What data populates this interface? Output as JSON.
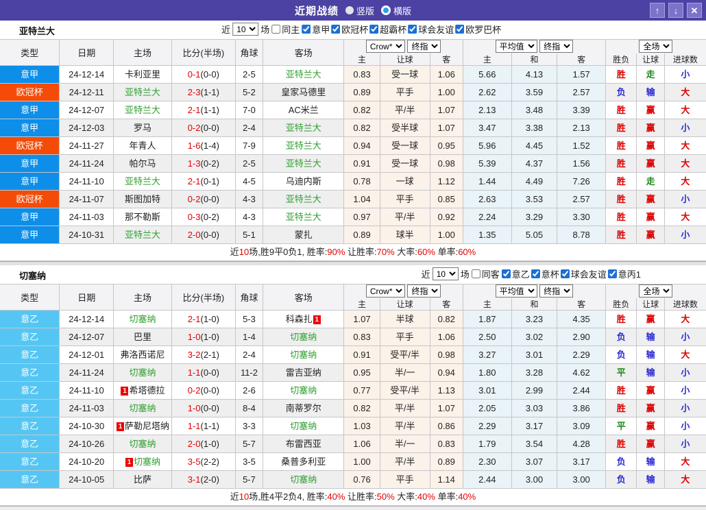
{
  "titlebar": {
    "title": "近期战绩",
    "vertical_label": "竖版",
    "horizontal_label": "横版",
    "selected_layout": "横版",
    "buttons": {
      "up": "↑",
      "down": "↓",
      "close": "✕"
    }
  },
  "table_header": {
    "type": "类型",
    "date": "日期",
    "home": "主场",
    "score": "比分(半场)",
    "corner": "角球",
    "away": "客场",
    "odds_source": "Crow*",
    "odds_kind": "终指",
    "avg_source": "平均值",
    "avg_kind": "终指",
    "scope_select": "全场",
    "h_home": "主",
    "h_handicap": "让球",
    "h_away": "客",
    "a_home": "主",
    "a_draw": "和",
    "a_away": "客",
    "r_wdl": "胜负",
    "r_handicap": "让球",
    "r_goals": "进球数"
  },
  "colors": {
    "titlebar_bg": "#4b42a3",
    "leagues": {
      "意甲": "#0d8ee9",
      "欧冠杯": "#f44c08",
      "意乙": "#55c6f3"
    },
    "results": {
      "胜": "#dd0000",
      "负": "#2a2ad2",
      "平": "#1d8a1d",
      "赢": "#dd0000",
      "输": "#2a2ad2",
      "走": "#1d8a1d",
      "大": "#dd0000",
      "小": "#2a2ad2"
    },
    "team_highlight": "#2f9e2f",
    "score_red": "#e10000",
    "red_card": "#ee0000"
  },
  "sections": [
    {
      "team": "亚特兰大",
      "filter": {
        "near": "近",
        "count": "10",
        "games": "场",
        "same": "同主",
        "comps": [
          "意甲",
          "欧冠杯",
          "超霸杯",
          "球会友谊",
          "欧罗巴杯"
        ]
      },
      "rows": [
        {
          "lg": "意甲",
          "date": "24-12-14",
          "home": "卡利亚里",
          "ft": "0-1",
          "half": "(0-0)",
          "corner": "2-5",
          "away": "亚特兰大",
          "ateam": true,
          "o": [
            "0.83",
            "受一球",
            "1.06"
          ],
          "avg": [
            "5.66",
            "4.13",
            "1.57"
          ],
          "res": [
            "胜",
            "走",
            "小"
          ]
        },
        {
          "lg": "欧冠杯",
          "date": "24-12-11",
          "home": "亚特兰大",
          "hteam": true,
          "ft": "2-3",
          "half": "(1-1)",
          "corner": "5-2",
          "away": "皇家马德里",
          "o": [
            "0.89",
            "平手",
            "1.00"
          ],
          "avg": [
            "2.62",
            "3.59",
            "2.57"
          ],
          "res": [
            "负",
            "输",
            "大"
          ]
        },
        {
          "lg": "意甲",
          "date": "24-12-07",
          "home": "亚特兰大",
          "hteam": true,
          "ft": "2-1",
          "half": "(1-1)",
          "corner": "7-0",
          "away": "AC米兰",
          "o": [
            "0.82",
            "平/半",
            "1.07"
          ],
          "avg": [
            "2.13",
            "3.48",
            "3.39"
          ],
          "res": [
            "胜",
            "赢",
            "大"
          ]
        },
        {
          "lg": "意甲",
          "date": "24-12-03",
          "home": "罗马",
          "ft": "0-2",
          "half": "(0-0)",
          "corner": "2-4",
          "away": "亚特兰大",
          "ateam": true,
          "o": [
            "0.82",
            "受半球",
            "1.07"
          ],
          "avg": [
            "3.47",
            "3.38",
            "2.13"
          ],
          "res": [
            "胜",
            "赢",
            "小"
          ]
        },
        {
          "lg": "欧冠杯",
          "date": "24-11-27",
          "home": "年青人",
          "ft": "1-6",
          "half": "(1-4)",
          "corner": "7-9",
          "away": "亚特兰大",
          "ateam": true,
          "o": [
            "0.94",
            "受一球",
            "0.95"
          ],
          "avg": [
            "5.96",
            "4.45",
            "1.52"
          ],
          "res": [
            "胜",
            "赢",
            "大"
          ]
        },
        {
          "lg": "意甲",
          "date": "24-11-24",
          "home": "帕尔马",
          "ft": "1-3",
          "half": "(0-2)",
          "corner": "2-5",
          "away": "亚特兰大",
          "ateam": true,
          "o": [
            "0.91",
            "受一球",
            "0.98"
          ],
          "avg": [
            "5.39",
            "4.37",
            "1.56"
          ],
          "res": [
            "胜",
            "赢",
            "大"
          ]
        },
        {
          "lg": "意甲",
          "date": "24-11-10",
          "home": "亚特兰大",
          "hteam": true,
          "ft": "2-1",
          "half": "(0-1)",
          "corner": "4-5",
          "away": "乌迪内斯",
          "o": [
            "0.78",
            "一球",
            "1.12"
          ],
          "avg": [
            "1.44",
            "4.49",
            "7.26"
          ],
          "res": [
            "胜",
            "走",
            "大"
          ]
        },
        {
          "lg": "欧冠杯",
          "date": "24-11-07",
          "home": "斯图加特",
          "ft": "0-2",
          "half": "(0-0)",
          "corner": "4-3",
          "away": "亚特兰大",
          "ateam": true,
          "o": [
            "1.04",
            "平手",
            "0.85"
          ],
          "avg": [
            "2.63",
            "3.53",
            "2.57"
          ],
          "res": [
            "胜",
            "赢",
            "小"
          ]
        },
        {
          "lg": "意甲",
          "date": "24-11-03",
          "home": "那不勒斯",
          "ft": "0-3",
          "half": "(0-2)",
          "corner": "4-3",
          "away": "亚特兰大",
          "ateam": true,
          "o": [
            "0.97",
            "平/半",
            "0.92"
          ],
          "avg": [
            "2.24",
            "3.29",
            "3.30"
          ],
          "res": [
            "胜",
            "赢",
            "大"
          ]
        },
        {
          "lg": "意甲",
          "date": "24-10-31",
          "home": "亚特兰大",
          "hteam": true,
          "ft": "2-0",
          "half": "(0-0)",
          "corner": "5-1",
          "away": "蒙扎",
          "o": [
            "0.89",
            "球半",
            "1.00"
          ],
          "avg": [
            "1.35",
            "5.05",
            "8.78"
          ],
          "res": [
            "胜",
            "赢",
            "小"
          ]
        }
      ],
      "summary": [
        {
          "t": "近"
        },
        {
          "t": "10",
          "red": true
        },
        {
          "t": "场,胜9平0负1, 胜率:"
        },
        {
          "t": "90%",
          "red": true
        },
        {
          "t": " 让胜率:"
        },
        {
          "t": "70%",
          "red": true
        },
        {
          "t": " 大率:"
        },
        {
          "t": "60%",
          "red": true
        },
        {
          "t": " 单率:"
        },
        {
          "t": "60%",
          "red": true
        }
      ]
    },
    {
      "team": "切塞纳",
      "filter": {
        "near": "近",
        "count": "10",
        "games": "场",
        "same": "同客",
        "comps": [
          "意乙",
          "意杯",
          "球会友谊",
          "意丙1"
        ]
      },
      "rows": [
        {
          "lg": "意乙",
          "date": "24-12-14",
          "home": "切塞纳",
          "hteam": true,
          "ft": "2-1",
          "half": "(1-0)",
          "corner": "5-3",
          "away": "科森扎",
          "arc": "post",
          "o": [
            "1.07",
            "半球",
            "0.82"
          ],
          "avg": [
            "1.87",
            "3.23",
            "4.35"
          ],
          "res": [
            "胜",
            "赢",
            "大"
          ]
        },
        {
          "lg": "意乙",
          "date": "24-12-07",
          "home": "巴里",
          "ft": "1-0",
          "half": "(1-0)",
          "corner": "1-4",
          "away": "切塞纳",
          "ateam": true,
          "o": [
            "0.83",
            "平手",
            "1.06"
          ],
          "avg": [
            "2.50",
            "3.02",
            "2.90"
          ],
          "res": [
            "负",
            "输",
            "小"
          ]
        },
        {
          "lg": "意乙",
          "date": "24-12-01",
          "home": "弗洛西诺尼",
          "ft": "3-2",
          "half": "(2-1)",
          "corner": "2-4",
          "away": "切塞纳",
          "ateam": true,
          "o": [
            "0.91",
            "受平/半",
            "0.98"
          ],
          "avg": [
            "3.27",
            "3.01",
            "2.29"
          ],
          "res": [
            "负",
            "输",
            "大"
          ]
        },
        {
          "lg": "意乙",
          "date": "24-11-24",
          "home": "切塞纳",
          "hteam": true,
          "ft": "1-1",
          "half": "(0-0)",
          "corner": "11-2",
          "away": "雷吉亚纳",
          "o": [
            "0.95",
            "半/一",
            "0.94"
          ],
          "avg": [
            "1.80",
            "3.28",
            "4.62"
          ],
          "res": [
            "平",
            "输",
            "小"
          ]
        },
        {
          "lg": "意乙",
          "date": "24-11-10",
          "home": "希塔德拉",
          "hrc": "pre",
          "ft": "0-2",
          "half": "(0-0)",
          "corner": "2-6",
          "away": "切塞纳",
          "ateam": true,
          "o": [
            "0.77",
            "受平/半",
            "1.13"
          ],
          "avg": [
            "3.01",
            "2.99",
            "2.44"
          ],
          "res": [
            "胜",
            "赢",
            "小"
          ]
        },
        {
          "lg": "意乙",
          "date": "24-11-03",
          "home": "切塞纳",
          "hteam": true,
          "ft": "1-0",
          "half": "(0-0)",
          "corner": "8-4",
          "away": "南蒂罗尔",
          "o": [
            "0.82",
            "平/半",
            "1.07"
          ],
          "avg": [
            "2.05",
            "3.03",
            "3.86"
          ],
          "res": [
            "胜",
            "赢",
            "小"
          ]
        },
        {
          "lg": "意乙",
          "date": "24-10-30",
          "home": "萨勒尼塔纳",
          "hrc": "pre",
          "ft": "1-1",
          "half": "(1-1)",
          "corner": "3-3",
          "away": "切塞纳",
          "ateam": true,
          "o": [
            "1.03",
            "平/半",
            "0.86"
          ],
          "avg": [
            "2.29",
            "3.17",
            "3.09"
          ],
          "res": [
            "平",
            "赢",
            "小"
          ]
        },
        {
          "lg": "意乙",
          "date": "24-10-26",
          "home": "切塞纳",
          "hteam": true,
          "ft": "2-0",
          "half": "(1-0)",
          "corner": "5-7",
          "away": "布雷西亚",
          "o": [
            "1.06",
            "半/一",
            "0.83"
          ],
          "avg": [
            "1.79",
            "3.54",
            "4.28"
          ],
          "res": [
            "胜",
            "赢",
            "小"
          ]
        },
        {
          "lg": "意乙",
          "date": "24-10-20",
          "home": "切塞纳",
          "hteam": true,
          "hrc": "pre",
          "ft": "3-5",
          "half": "(2-2)",
          "corner": "3-5",
          "away": "桑普多利亚",
          "o": [
            "1.00",
            "平/半",
            "0.89"
          ],
          "avg": [
            "2.30",
            "3.07",
            "3.17"
          ],
          "res": [
            "负",
            "输",
            "大"
          ]
        },
        {
          "lg": "意乙",
          "date": "24-10-05",
          "home": "比萨",
          "ft": "3-1",
          "half": "(2-0)",
          "corner": "5-7",
          "away": "切塞纳",
          "ateam": true,
          "o": [
            "0.76",
            "平手",
            "1.14"
          ],
          "avg": [
            "2.44",
            "3.00",
            "3.00"
          ],
          "res": [
            "负",
            "输",
            "大"
          ]
        }
      ],
      "summary": [
        {
          "t": "近"
        },
        {
          "t": "10",
          "red": true
        },
        {
          "t": "场,胜4平2负4, 胜率:"
        },
        {
          "t": "40%",
          "red": true
        },
        {
          "t": " 让胜率:"
        },
        {
          "t": "50%",
          "red": true
        },
        {
          "t": " 大率:"
        },
        {
          "t": "40%",
          "red": true
        },
        {
          "t": " 单率:"
        },
        {
          "t": "40%",
          "red": true
        }
      ]
    }
  ]
}
